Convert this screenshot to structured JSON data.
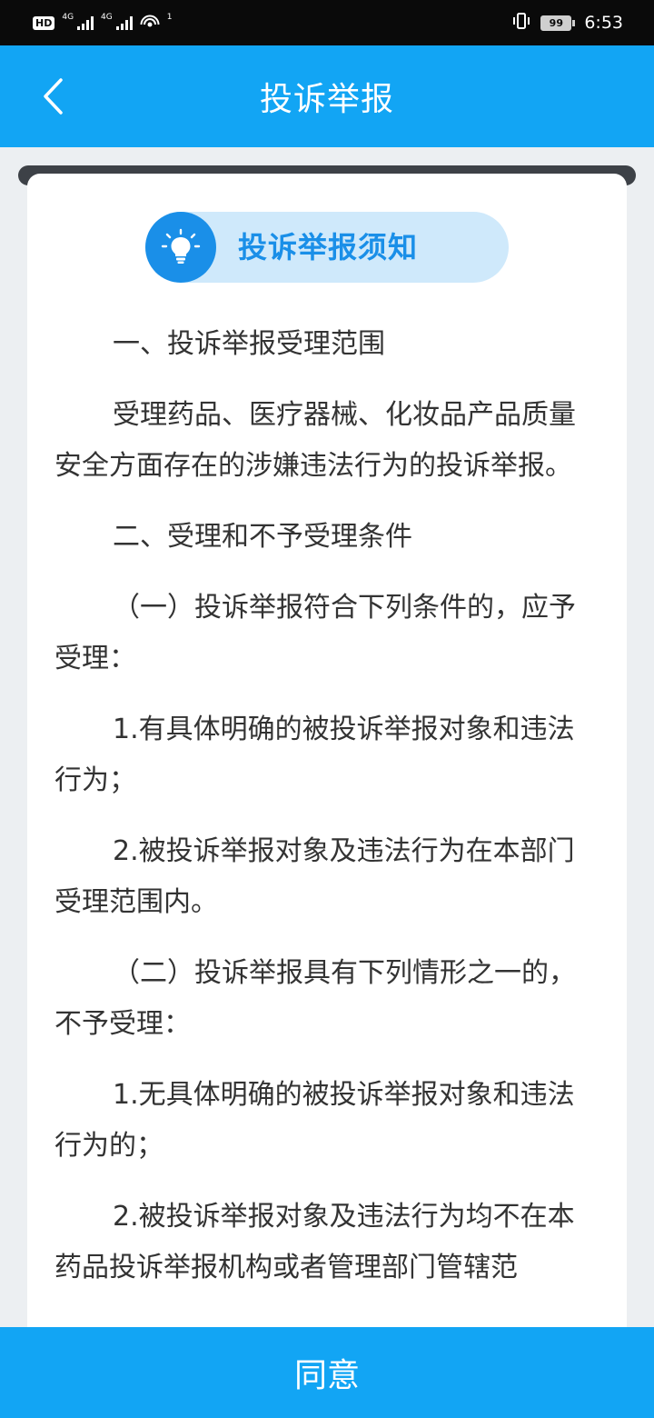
{
  "status_bar": {
    "hd": "HD",
    "network_1": "4G",
    "network_2": "4G",
    "wifi_badge": "1",
    "battery": "99",
    "time": "6:53"
  },
  "header": {
    "title": "投诉举报"
  },
  "notice": {
    "title": "投诉举报须知",
    "icon": "lightbulb-icon"
  },
  "content": {
    "paragraphs": [
      "一、投诉举报受理范围",
      "受理药品、医疗器械、化妆品产品质量安全方面存在的涉嫌违法行为的投诉举报。",
      "二、受理和不予受理条件",
      "（一）投诉举报符合下列条件的，应予受理：",
      "1.有具体明确的被投诉举报对象和违法行为；",
      "2.被投诉举报对象及违法行为在本部门受理范围内。",
      "（二）投诉举报具有下列情形之一的，不予受理：",
      "1.无具体明确的被投诉举报对象和违法行为的；",
      "2.被投诉举报对象及违法行为均不在本药品投诉举报机构或者管理部门管辖范"
    ]
  },
  "footer": {
    "agree_label": "同意"
  },
  "colors": {
    "primary": "#12a5f4",
    "accent": "#1a8fe8",
    "pill_bg": "#cfe9fb",
    "text": "#333333"
  }
}
